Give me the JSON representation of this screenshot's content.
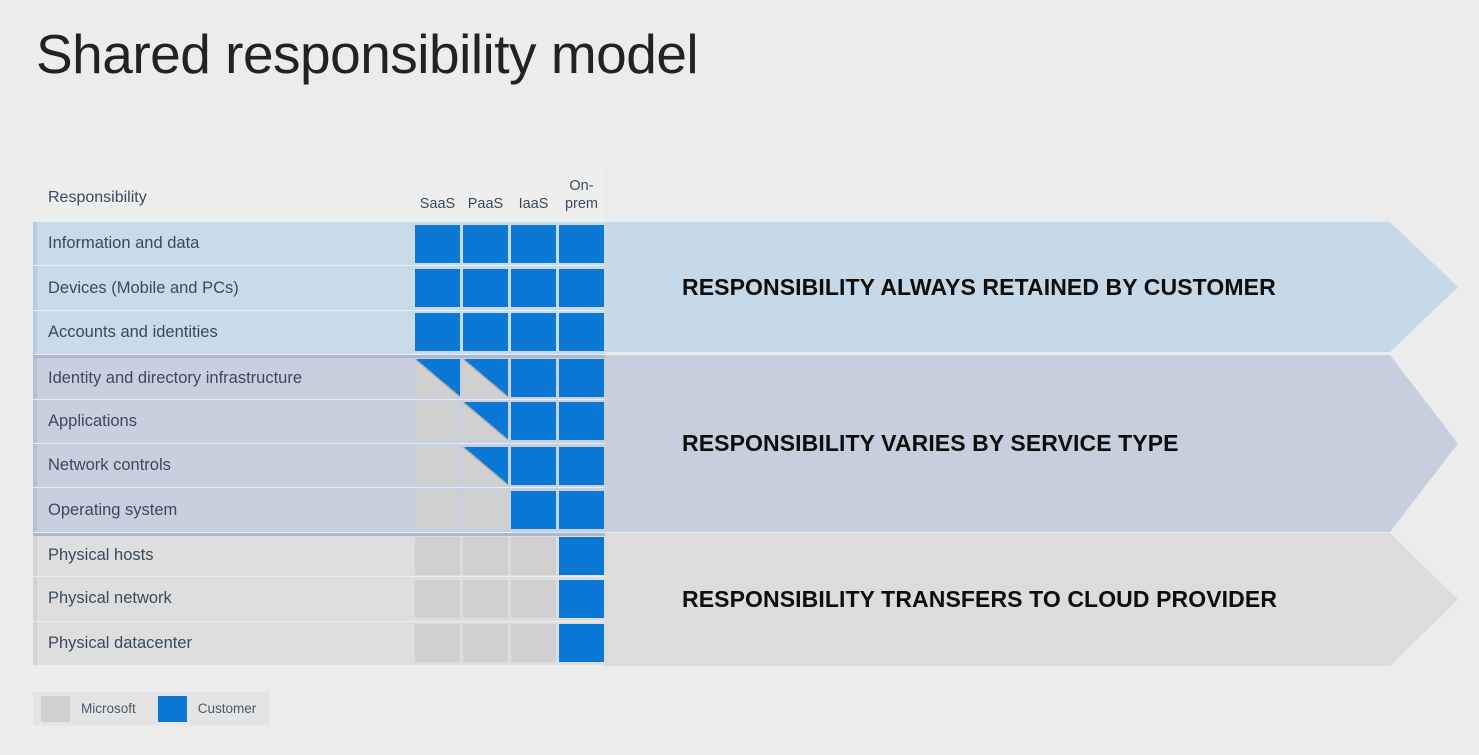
{
  "title": "Shared responsibility model",
  "table": {
    "header_label": "Responsibility",
    "columns": [
      {
        "id": "saas",
        "label": "SaaS"
      },
      {
        "id": "paas",
        "label": "PaaS"
      },
      {
        "id": "iaas",
        "label": "IaaS"
      },
      {
        "id": "onprem",
        "label": "On-\nprem"
      }
    ],
    "column_labels": {
      "saas": "SaaS",
      "paas": "PaaS",
      "iaas": "IaaS",
      "onprem_line1": "On-",
      "onprem_line2": "prem"
    },
    "rows": [
      {
        "label": "Information and data",
        "group": 0,
        "cells": [
          "customer",
          "customer",
          "customer",
          "customer"
        ]
      },
      {
        "label": "Devices (Mobile and PCs)",
        "group": 0,
        "cells": [
          "customer",
          "customer",
          "customer",
          "customer"
        ]
      },
      {
        "label": "Accounts and identities",
        "group": 0,
        "cells": [
          "customer",
          "customer",
          "customer",
          "customer"
        ]
      },
      {
        "label": "Identity and directory infrastructure",
        "group": 1,
        "cells": [
          "split",
          "split",
          "customer",
          "customer"
        ]
      },
      {
        "label": "Applications",
        "group": 1,
        "cells": [
          "microsoft",
          "split",
          "customer",
          "customer"
        ]
      },
      {
        "label": "Network controls",
        "group": 1,
        "cells": [
          "microsoft",
          "split",
          "customer",
          "customer"
        ]
      },
      {
        "label": "Operating system",
        "group": 1,
        "cells": [
          "microsoft",
          "microsoft",
          "customer",
          "customer"
        ]
      },
      {
        "label": "Physical hosts",
        "group": 2,
        "cells": [
          "microsoft",
          "microsoft",
          "microsoft",
          "customer"
        ]
      },
      {
        "label": "Physical network",
        "group": 2,
        "cells": [
          "microsoft",
          "microsoft",
          "microsoft",
          "customer"
        ]
      },
      {
        "label": "Physical datacenter",
        "group": 2,
        "cells": [
          "microsoft",
          "microsoft",
          "microsoft",
          "customer"
        ]
      }
    ]
  },
  "banners": [
    {
      "label": "RESPONSIBILITY ALWAYS RETAINED BY CUSTOMER",
      "color": "#c5d9e8"
    },
    {
      "label": "RESPONSIBILITY VARIES BY SERVICE TYPE",
      "color": "#c7cfdf"
    },
    {
      "label": "RESPONSIBILITY TRANSFERS TO CLOUD PROVIDER",
      "color": "#dcdcdc"
    }
  ],
  "legend": [
    {
      "key": "microsoft",
      "label": "Microsoft",
      "color": "#d0d0d0"
    },
    {
      "key": "customer",
      "label": "Customer",
      "color": "#0a78d4"
    }
  ],
  "colors": {
    "background": "#ececec",
    "customer_blue": "#0a78d4",
    "microsoft_gray": "#d0d0d0",
    "group0_tint": "#c7dbe8",
    "group1_tint": "#c8d0e0",
    "group2_tint": "#dedede",
    "text": "#3b4a5a",
    "title": "#222222"
  }
}
